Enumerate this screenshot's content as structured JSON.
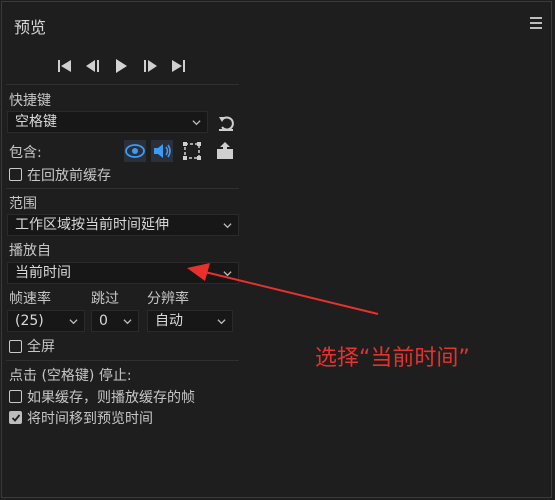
{
  "panel": {
    "title": "预览",
    "menu_icon": "hamburger-menu-icon"
  },
  "transport": {
    "icons": [
      "go-to-start-icon",
      "step-back-icon",
      "play-icon",
      "step-forward-icon",
      "go-to-end-icon"
    ]
  },
  "shortcut": {
    "label": "快捷键",
    "value": "空格键",
    "reset_icon": "reset-icon"
  },
  "include": {
    "label": "包含:",
    "icons": [
      "eye-icon",
      "speaker-icon",
      "crop-frame-icon",
      "export-icon"
    ],
    "cache_checkbox": {
      "label": "在回放前缓存",
      "checked": false
    }
  },
  "range": {
    "label": "范围",
    "value": "工作区域按当前时间延伸"
  },
  "play_from": {
    "label": "播放自",
    "value": "当前时间"
  },
  "frame_rate": {
    "label": "帧速率",
    "value": "(25)"
  },
  "skip": {
    "label": "跳过",
    "value": "0"
  },
  "resolution": {
    "label": "分辨率",
    "value": "自动"
  },
  "fullscreen": {
    "label": "全屏",
    "checked": false
  },
  "click_stop": {
    "label": "点击 (空格键) 停止:",
    "option1": {
      "label": "如果缓存，则播放缓存的帧",
      "checked": false
    },
    "option2": {
      "label": "将时间移到预览时间",
      "checked": true
    }
  },
  "annotation": {
    "text": "选择“当前时间”",
    "color": "#e8312c"
  }
}
